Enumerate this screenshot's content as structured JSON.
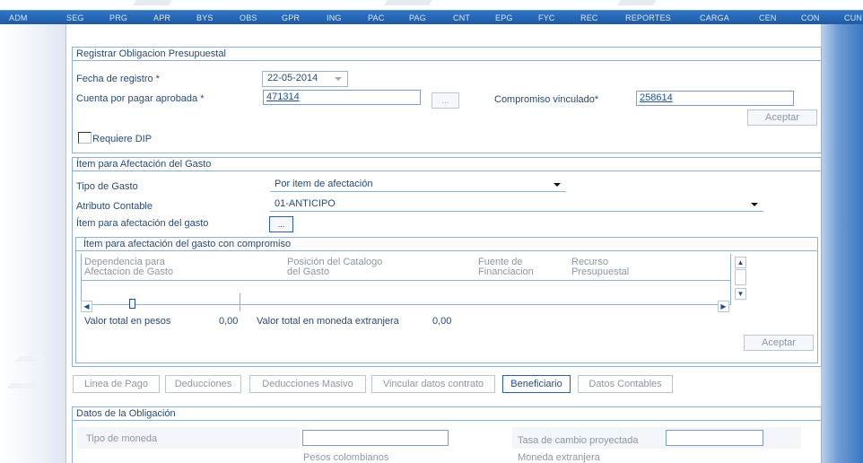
{
  "menu": {
    "items": [
      "ADM",
      "SEG",
      "PRG",
      "APR",
      "BYS",
      "OBS",
      "GPR",
      "ING",
      "PAC",
      "PAG",
      "CNT",
      "EPG",
      "FYC",
      "REC",
      "REPORTES",
      "CARGA",
      "CEN",
      "CON",
      "CUN"
    ]
  },
  "registrar": {
    "title": "Registrar Obligacion Presupuestal",
    "fecha_label": "Fecha de registro *",
    "fecha_value": "22-05-2014",
    "cuenta_label": "Cuenta por pagar aprobada  *",
    "cuenta_value": "471314",
    "lookup_label": "...",
    "compromiso_label": "Compromiso vinculado*",
    "compromiso_value": "258614",
    "aceptar_label": "Aceptar",
    "requiere_dip_label": "Requiere DIP"
  },
  "item_gasto": {
    "title": "Ítem para Afectación del Gasto",
    "tipo_gasto_label": "Tipo de Gasto",
    "tipo_gasto_value": "Por item de afectación",
    "atributo_label": "Atributo Contable",
    "atributo_value": "01-ANTICIPO",
    "item_label": "Ítem para afectación del gasto",
    "item_button": "..."
  },
  "compromiso_grid": {
    "title": "Ítem para afectación del gasto con compromiso",
    "columns": [
      {
        "line1": "Dependencia para",
        "line2": "Afectacion de Gasto"
      },
      {
        "line1": "Posición del Catalogo",
        "line2": "del Gasto"
      },
      {
        "line1": "Fuente de",
        "line2": "Financiacion"
      },
      {
        "line1": "Recurso",
        "line2": "Presupuestal"
      }
    ],
    "valor_pesos_label": "Valor total en pesos",
    "valor_pesos_value": "0,00",
    "valor_extranjera_label": "Valor total en moneda extranjera",
    "valor_extranjera_value": "0,00",
    "aceptar_label": "Aceptar"
  },
  "tabs": [
    {
      "label": "Linea de Pago",
      "active": false
    },
    {
      "label": "Deducciones",
      "active": false
    },
    {
      "label": "Deducciones Masivo",
      "active": false
    },
    {
      "label": "Vincular datos contrato",
      "active": false
    },
    {
      "label": "Beneficiario",
      "active": true
    },
    {
      "label": "Datos Contables",
      "active": false
    }
  ],
  "datos_obligacion": {
    "title": "Datos de la Obligación",
    "tipo_moneda_label": "Tipo de moneda",
    "tasa_label": "Tasa de cambio proyectada",
    "pesos_label": "Pesos colombianos",
    "extranjera_label": "Moneda extranjera"
  },
  "colors": {
    "menu_bar": "#1f5aa6",
    "label_text": "#2a4a78",
    "link_value": "#1d4e9e",
    "disabled_text": "#8b98a8",
    "border": "#8fb1d8"
  }
}
